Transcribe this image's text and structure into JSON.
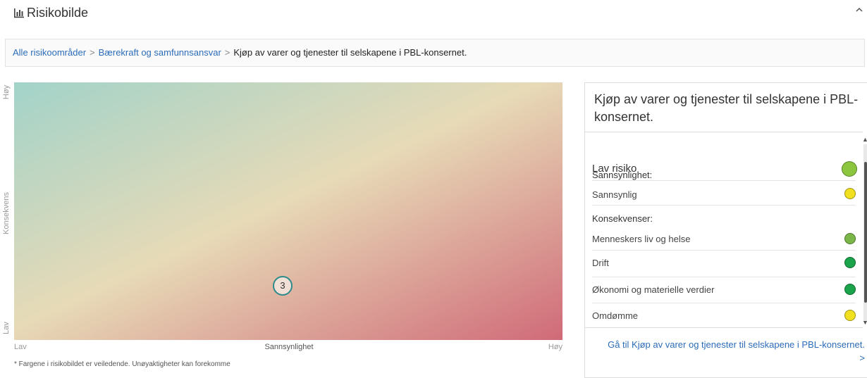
{
  "header": {
    "title": "Risikobilde",
    "icon": "bar-chart-icon",
    "collapse_icon": "chevron-up-icon"
  },
  "breadcrumb": {
    "items": [
      "Alle risikoområder",
      "Bærekraft og samfunnsansvar"
    ],
    "separator": ">",
    "current": "Kjøp av varer og tjenester til selskapene i PBL-konsernet."
  },
  "matrix": {
    "y_axis": {
      "label": "Konsekvens",
      "low": "Lav",
      "high": "Høy"
    },
    "x_axis": {
      "label": "Sannsynlighet",
      "low": "Lav",
      "high": "Høy"
    },
    "note": "* Fargene i risikobildet er veiledende. Unøyaktigheter kan forekomme",
    "risk_marker": {
      "label": "3"
    },
    "colors": {
      "low": "#a2d3c9",
      "mid": "#e7dab7",
      "high": "#d06a78"
    }
  },
  "panel": {
    "title": "Kjøp av varer og tjenester til selskapene i PBL-konsernet.",
    "risk_level": {
      "label": "Lav risiko",
      "color": "#8cc63f"
    },
    "probability": {
      "heading": "Sannsynlighet:",
      "value": "Sannsynlig",
      "color": "#f0e020"
    },
    "consequences": {
      "heading": "Konsekvenser:",
      "items": [
        {
          "label": "Menneskers liv og helse",
          "color": "#7ab648"
        },
        {
          "label": "Drift",
          "color": "#1aa34a"
        },
        {
          "label": "Økonomi og materielle verdier",
          "color": "#1aa34a"
        },
        {
          "label": "Omdømme",
          "color": "#f0e020"
        }
      ]
    },
    "link": "Gå til Kjøp av varer og tjenester til selskapene i PBL-konsernet. >"
  }
}
